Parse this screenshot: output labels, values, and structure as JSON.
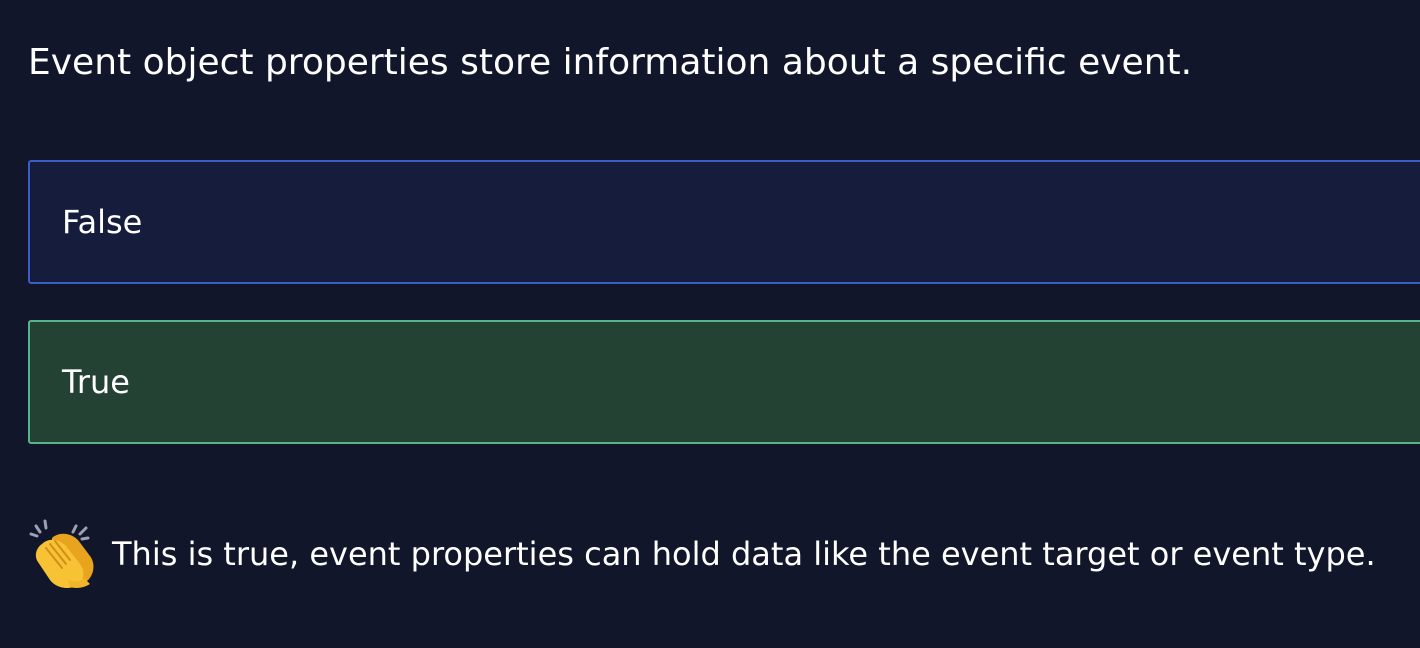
{
  "question": {
    "text": "Event object properties store information about a specific event."
  },
  "options": [
    {
      "label": "False",
      "state": "unselected",
      "border_color": "#3a5cc4",
      "background_color": "#161c3b"
    },
    {
      "label": "True",
      "state": "correct",
      "border_color": "#55b48a",
      "background_color": "#234234"
    }
  ],
  "feedback": {
    "icon": "clapping-hands-icon",
    "text": "This is true, event properties can hold data like the event target or event type."
  },
  "colors": {
    "background": "#12162b",
    "text": "#ffffff"
  }
}
